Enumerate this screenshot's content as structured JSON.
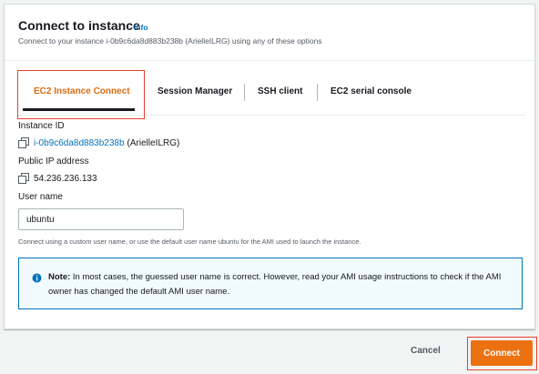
{
  "modal": {
    "title": "Connect to instance",
    "info_link": "Info",
    "subtitle": "Connect to your instance i-0b9c6da8d883b238b (ArielleILRG) using any of these options"
  },
  "tabs": [
    {
      "label": "EC2 Instance Connect",
      "active": true
    },
    {
      "label": "Session Manager",
      "active": false
    },
    {
      "label": "SSH client",
      "active": false
    },
    {
      "label": "EC2 serial console",
      "active": false
    }
  ],
  "instance": {
    "id_label": "Instance ID",
    "id_value": "i-0b9c6da8d883b238b",
    "id_name": "(ArielleILRG)",
    "ip_label": "Public IP address",
    "ip_value": "54.236.236.133"
  },
  "username": {
    "label": "User name",
    "value": "ubuntu",
    "hint": "Connect using a custom user name, or use the default user name ubuntu for the AMI used to launch the instance."
  },
  "note": {
    "prefix": "Note:",
    "text": " In most cases, the guessed user name is correct. However, read your AMI usage instructions to check if the AMI owner has changed the default AMI user name."
  },
  "footer": {
    "cancel_label": "Cancel",
    "connect_label": "Connect"
  },
  "colors": {
    "accent": "#ec7211",
    "link": "#0073bb",
    "highlight": "#e8402e"
  }
}
